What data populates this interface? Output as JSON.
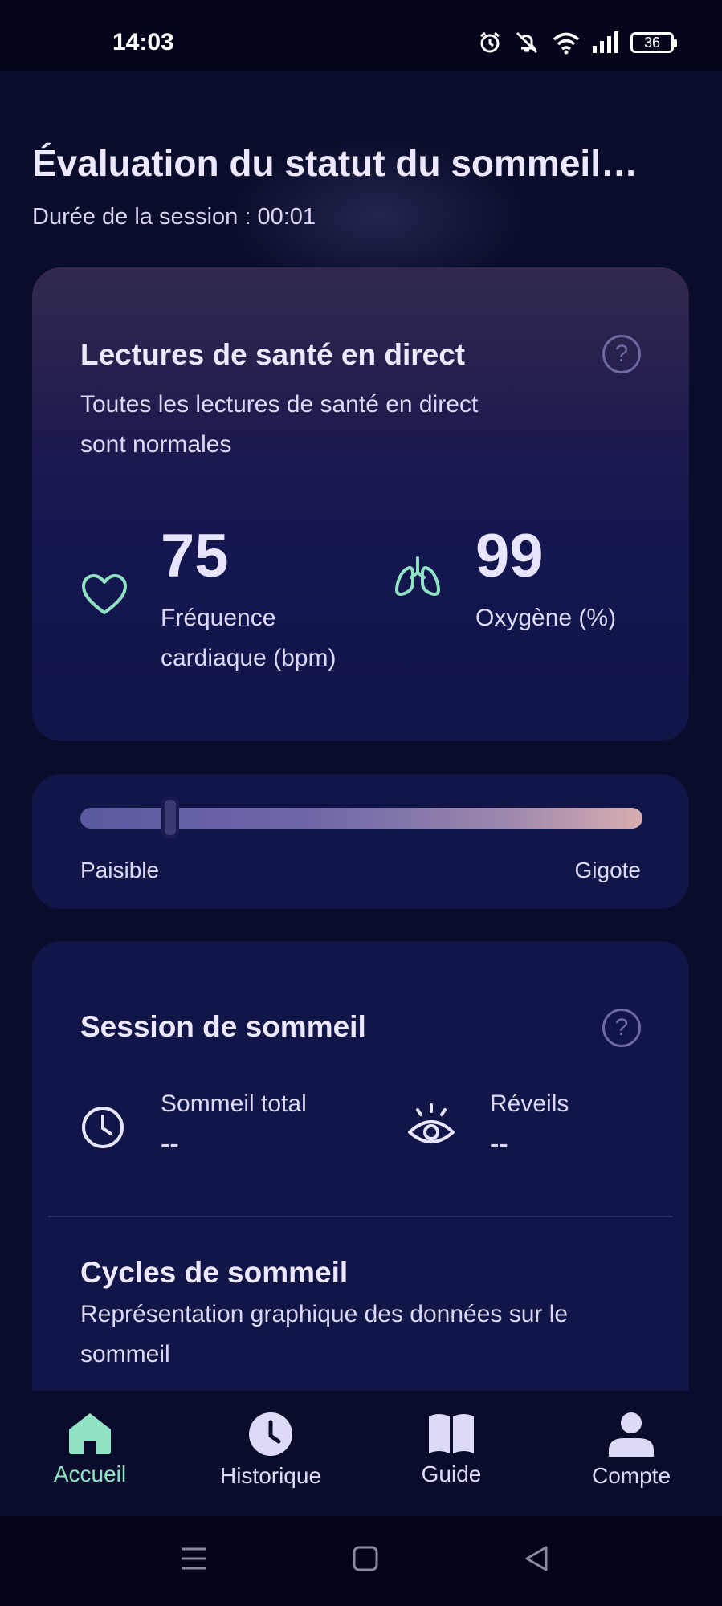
{
  "status_bar": {
    "time": "14:03",
    "battery": "36",
    "icons": [
      "alarm-icon",
      "mute-icon",
      "wifi-icon",
      "signal-icon",
      "battery-icon"
    ]
  },
  "header": {
    "title": "Évaluation du statut du sommeil…",
    "session_duration": "Durée de la session : 00:01"
  },
  "health_card": {
    "title": "Lectures de santé en direct",
    "subtitle": "Toutes les lectures de santé en direct sont normales",
    "heart_rate": {
      "value": "75",
      "label": "Fréquence cardiaque (bpm)",
      "icon": "heart-icon"
    },
    "oxygen": {
      "value": "99",
      "label": "Oxygène (%)",
      "icon": "lungs-icon"
    }
  },
  "movement_slider": {
    "left_label": "Paisible",
    "right_label": "Gigote",
    "level": 0.16
  },
  "session_card": {
    "title": "Session de sommeil",
    "total_sleep": {
      "label": "Sommeil total",
      "value": "--",
      "icon": "clock-icon"
    },
    "wakeups": {
      "label": "Réveils",
      "value": "--",
      "icon": "eye-icon"
    },
    "cycles_title": "Cycles de sommeil",
    "cycles_subtitle": "Représentation graphique des données sur le sommeil"
  },
  "bottom_nav": {
    "items": [
      {
        "label": "Accueil",
        "icon": "home-icon",
        "active": true
      },
      {
        "label": "Historique",
        "icon": "history-icon",
        "active": false
      },
      {
        "label": "Guide",
        "icon": "book-icon",
        "active": false
      },
      {
        "label": "Compte",
        "icon": "account-icon",
        "active": false
      }
    ]
  },
  "colors": {
    "background": "#0a0c2b",
    "card": "#121548",
    "accent": "#8fe3c2",
    "text": "#e8e6ff"
  }
}
